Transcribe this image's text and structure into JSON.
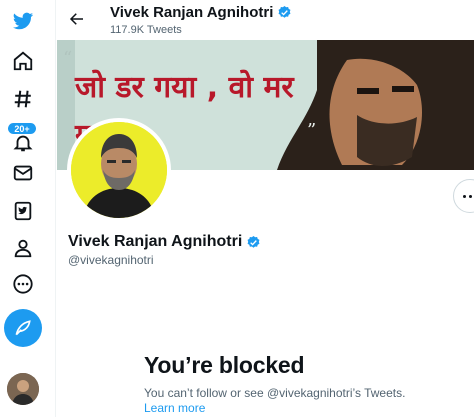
{
  "header": {
    "name": "Vivek Ranjan Agnihotri",
    "tweet_count": "117.9K Tweets"
  },
  "profile": {
    "name": "Vivek Ranjan Agnihotri",
    "handle": "@vivekagnihotri",
    "banner_quote": "जो डर गया , वो मर गया ।"
  },
  "nav": {
    "notifications_badge": "20+"
  },
  "blocked": {
    "title": "You’re blocked",
    "message": "You can’t follow or see @vivekagnihotri’s Tweets.",
    "link": "Learn more"
  },
  "colors": {
    "accent": "#1d9bf0",
    "avatar_bg": "#ecec2a",
    "muted_text": "#536471"
  }
}
